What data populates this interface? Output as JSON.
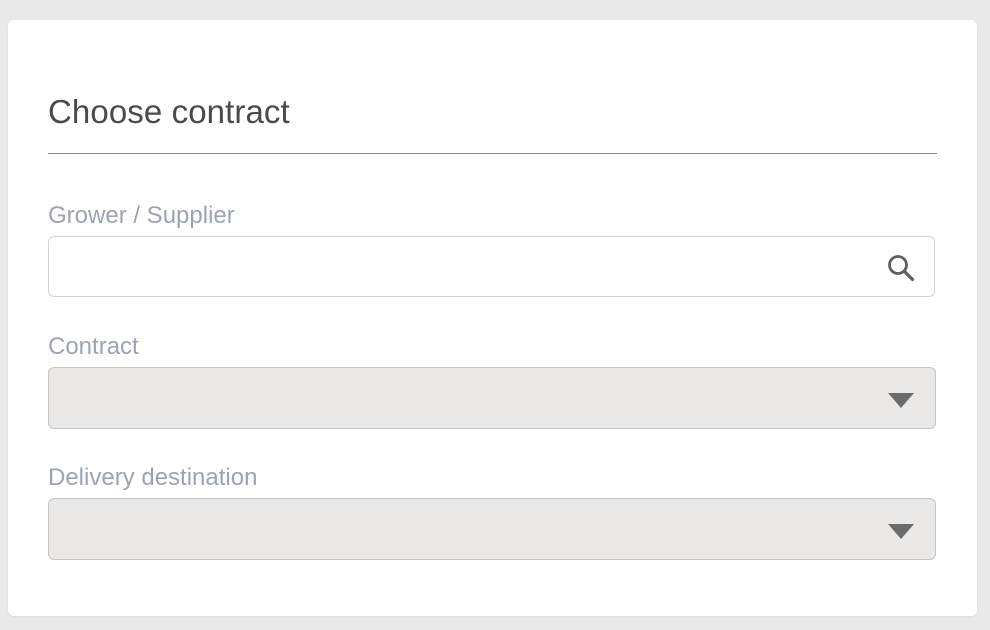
{
  "form": {
    "title": "Choose contract",
    "fields": {
      "grower_supplier": {
        "label": "Grower / Supplier",
        "value": "",
        "icon": "search-icon"
      },
      "contract": {
        "label": "Contract",
        "selected": "",
        "icon": "chevron-down-icon"
      },
      "delivery_destination": {
        "label": "Delivery destination",
        "selected": "",
        "icon": "chevron-down-icon"
      }
    }
  },
  "colors": {
    "background": "#e9e9e9",
    "card": "#ffffff",
    "title": "#4a4a4a",
    "label": "#9aa4b5",
    "select_fill": "#ebe9e7",
    "icon": "#6b6b6b"
  }
}
